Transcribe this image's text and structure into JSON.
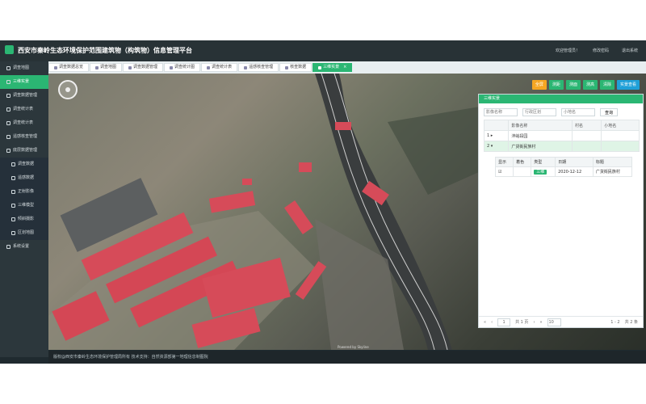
{
  "header": {
    "title": "西安市秦岭生态环境保护范围建筑物（构筑物）信息管理平台",
    "welcome": "欢迎管理员！",
    "change_password": "修改密码",
    "logout": "退出系统"
  },
  "sidebar": {
    "items": [
      {
        "label": "调查地图",
        "active": false,
        "sub": false
      },
      {
        "label": "三维实景",
        "active": true,
        "sub": false
      },
      {
        "label": "调查数据管理",
        "active": false,
        "sub": false
      },
      {
        "label": "调查统计表",
        "active": false,
        "sub": false
      },
      {
        "label": "调查统计表",
        "active": false,
        "sub": false
      },
      {
        "label": "遥感核查管理",
        "active": false,
        "sub": false
      },
      {
        "label": "底层数据管理",
        "active": false,
        "sub": false
      },
      {
        "label": "调查数据",
        "active": false,
        "sub": true
      },
      {
        "label": "遥感数据",
        "active": false,
        "sub": true
      },
      {
        "label": "正射影像",
        "active": false,
        "sub": true
      },
      {
        "label": "三维模型",
        "active": false,
        "sub": true
      },
      {
        "label": "倾斜摄影",
        "active": false,
        "sub": true
      },
      {
        "label": "区划地图",
        "active": false,
        "sub": true
      },
      {
        "label": "系统设置",
        "active": false,
        "sub": false
      }
    ]
  },
  "tabs": [
    {
      "label": "调查数据总览",
      "active": false
    },
    {
      "label": "调查地图",
      "active": false
    },
    {
      "label": "调查数据管理",
      "active": false
    },
    {
      "label": "调查统计图",
      "active": false
    },
    {
      "label": "调查统计表",
      "active": false
    },
    {
      "label": "遥感核查管理",
      "active": false
    },
    {
      "label": "核查数据",
      "active": false
    },
    {
      "label": "三维实景",
      "active": true
    }
  ],
  "toolbar": {
    "buttons": [
      {
        "label": "全屏",
        "style": "primary"
      },
      {
        "label": "测距",
        "style": "green"
      },
      {
        "label": "测面",
        "style": "green"
      },
      {
        "label": "测高",
        "style": "green"
      },
      {
        "label": "清除",
        "style": "green"
      },
      {
        "label": "实景查看",
        "style": "blue"
      }
    ]
  },
  "panel": {
    "title": "三维实景",
    "search": {
      "placeholder1": "影像名称",
      "placeholder2": "行政区划",
      "placeholder3": "小地名",
      "button": "查询"
    },
    "columns": [
      "",
      "影像名称",
      "村名",
      "小地名"
    ],
    "rows": [
      {
        "index": "1",
        "name": "沣峪段园",
        "village": "",
        "place": ""
      },
      {
        "index": "2",
        "name": "广货街民族村",
        "village": "",
        "place": ""
      }
    ],
    "sub_table": {
      "columns": [
        "显示",
        "着色",
        "类型",
        "日期",
        "标题"
      ],
      "rows": [
        {
          "type": "三维",
          "date": "2020-12-12",
          "title": "广货街民族村"
        }
      ]
    },
    "pager": {
      "page": "1",
      "total_pages": "共 1 页",
      "page_size": "10",
      "range": "1 - 2",
      "total": "共 2 条"
    }
  },
  "footer": {
    "copyright": "版权@西安市秦岭生态环境保护管理局所有   技术支持：自然资源部第一地理信息制图院"
  },
  "map": {
    "watermark": "Powered by Skyline"
  },
  "colors": {
    "accent": "#2bb673",
    "header_bg": "#283236",
    "sidebar_bg": "#2c373c"
  }
}
